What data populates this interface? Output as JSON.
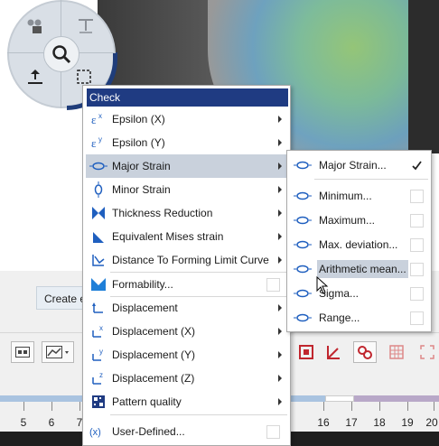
{
  "menu": {
    "header": "Check",
    "items": [
      {
        "label": "Epsilon (X)",
        "icon": "epsilon-x-icon",
        "submenu": true
      },
      {
        "label": "Epsilon (Y)",
        "icon": "epsilon-y-icon",
        "submenu": true
      },
      {
        "label": "Major Strain",
        "icon": "strain-ellipse-icon",
        "submenu": true,
        "selected": true
      },
      {
        "label": "Minor Strain",
        "icon": "minor-strain-icon",
        "submenu": true
      },
      {
        "label": "Thickness Reduction",
        "icon": "thickness-reduction-icon",
        "submenu": true
      },
      {
        "label": "Equivalent Mises strain",
        "icon": "mises-strain-icon",
        "submenu": true
      },
      {
        "label": "Distance To Forming Limit Curve",
        "icon": "flc-distance-icon",
        "submenu": true
      },
      {
        "label": "Formability...",
        "icon": "formability-icon",
        "checkbox": true
      },
      {
        "label": "Displacement",
        "icon": "displacement-icon",
        "submenu": true
      },
      {
        "label": "Displacement (X)",
        "icon": "displacement-x-icon",
        "submenu": true
      },
      {
        "label": "Displacement (Y)",
        "icon": "displacement-y-icon",
        "submenu": true
      },
      {
        "label": "Displacement (Z)",
        "icon": "displacement-z-icon",
        "submenu": true
      },
      {
        "label": "Pattern quality",
        "icon": "pattern-quality-icon",
        "submenu": true
      },
      {
        "label": "User-Defined...",
        "icon": "user-defined-icon",
        "checkbox": true
      }
    ]
  },
  "submenu": {
    "items": [
      {
        "label": "Major Strain...",
        "checked": true
      },
      {
        "label": "Minimum...",
        "checked": false
      },
      {
        "label": "Maximum...",
        "checked": false
      },
      {
        "label": "Max. deviation...",
        "checked": false
      },
      {
        "label": "Arithmetic mean...",
        "checked": false,
        "highlighted": true
      },
      {
        "label": "Sigma...",
        "checked": false
      },
      {
        "label": "Range...",
        "checked": false
      }
    ]
  },
  "background": {
    "create_button_label": "Create e"
  },
  "ruler": {
    "ticks": [
      "5",
      "6",
      "7",
      "16",
      "17",
      "18",
      "19",
      "20"
    ]
  },
  "colors": {
    "header_bg": "#1f3b82",
    "selection_bg": "#c9d1dc",
    "icon_blue": "#1f5fbf",
    "toolbar_red": "#c0262e"
  }
}
